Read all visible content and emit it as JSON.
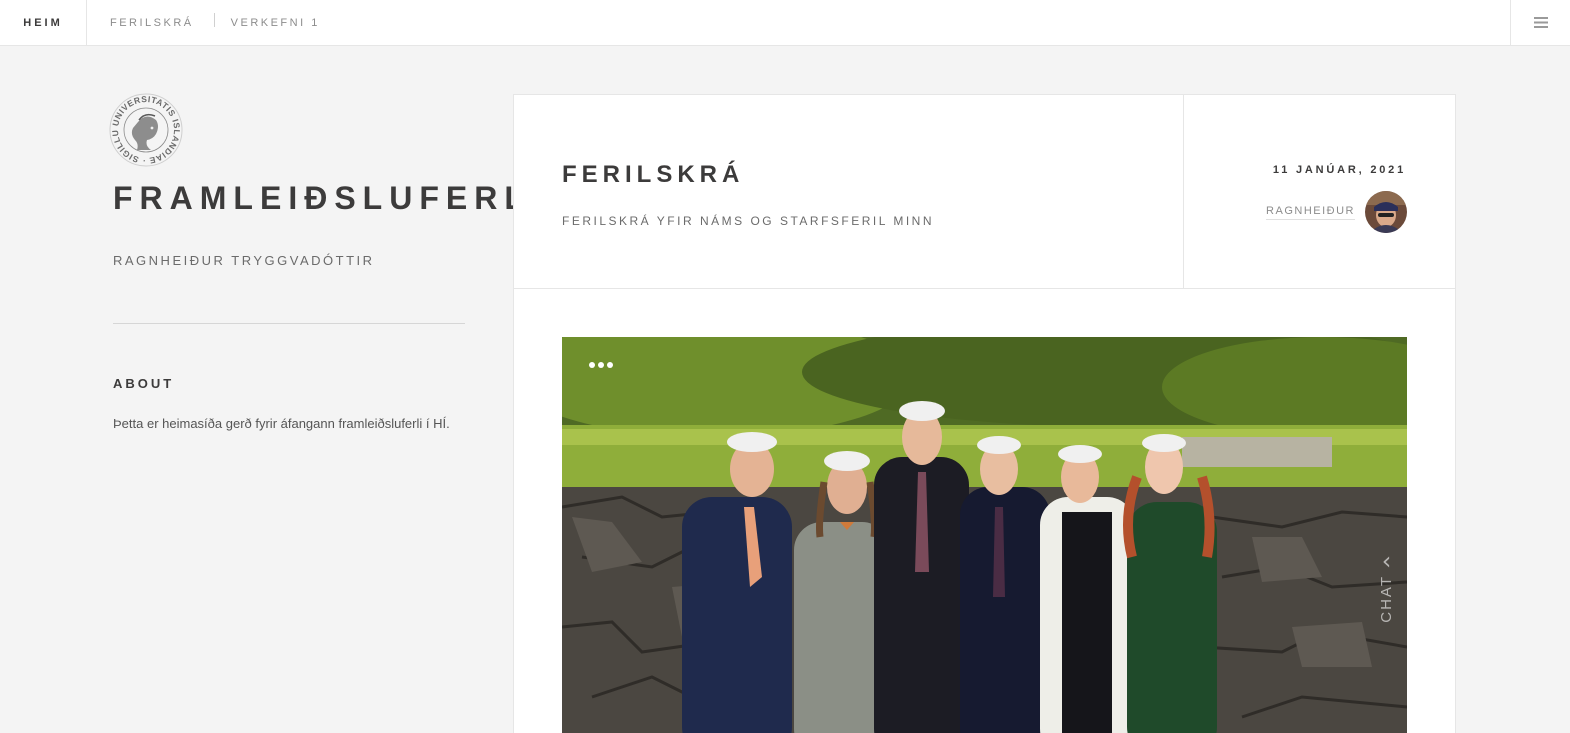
{
  "nav": {
    "home": "HEIM",
    "links": [
      "FERILSKRÁ",
      "VERKEFNI 1"
    ]
  },
  "sidebar": {
    "title": "FRAMLEIÐSLUFERLI",
    "subtitle": "RAGNHEIÐUR TRYGGVADÓTTIR",
    "seal_text": "UNIVERSITATIS ISLANDIAE SIGILLUM",
    "about_heading": "ABOUT",
    "about_text": "Þetta er heimasíða gerð fyrir áfangann framleiðsluferli í HÍ."
  },
  "post": {
    "title": "FERILSKRÁ",
    "description": "FERILSKRÁ YFIR NÁMS OG STARFSFERIL MINN",
    "date": "11 JANÚAR, 2021",
    "author": "RAGNHEIÐUR",
    "chat_label": "CHAT"
  },
  "colors": {
    "background": "#f4f4f4",
    "text": "#3c3b3b",
    "muted": "#8c8c8c",
    "border": "#e6e6e6"
  },
  "icons": {
    "menu": "hamburger-icon",
    "more": "dots-icon",
    "chat_arrow": "chevron-left-icon"
  }
}
